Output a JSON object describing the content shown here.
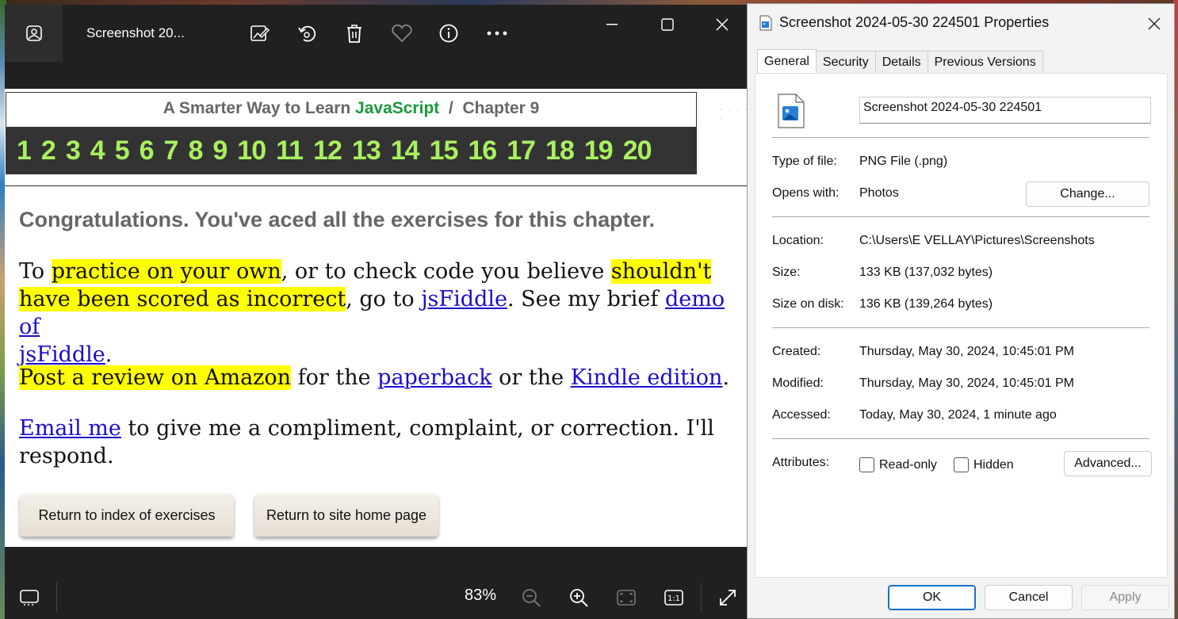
{
  "photos": {
    "title": "Screenshot 20...",
    "toolbar_icons": [
      "edit-image-icon",
      "rotate-icon",
      "delete-icon",
      "favorite-icon",
      "info-icon",
      "more-icon"
    ],
    "zoom": "83%",
    "bottom_icons": [
      "filmstrip-icon",
      "zoom-out-icon",
      "zoom-in-icon",
      "fit-to-window-icon",
      "actual-size-icon",
      "fullscreen-icon"
    ]
  },
  "webpage": {
    "header_prefix": "A Smarter Way to Learn ",
    "header_js": "JavaScript",
    "header_suffix": "  /  Chapter 9",
    "chapters": [
      "1",
      "2",
      "3",
      "4",
      "5",
      "6",
      "7",
      "8",
      "9",
      "10",
      "11",
      "12",
      "13",
      "14",
      "15",
      "16",
      "17",
      "18",
      "19",
      "20"
    ],
    "congrats": "Congratulations. You've aced all the exercises for this chapter.",
    "p1": {
      "t1": "To ",
      "hl1": "practice on your own",
      "t2": ", or to check code you believe ",
      "hl2a": "shouldn't",
      "hl2b": "have been scored as incorrect",
      "t3": ", go to ",
      "link1": "jsFiddle",
      "t4": ". See my brief ",
      "link2a": "demo of",
      "link2b": "jsFiddle",
      "t5": "."
    },
    "p2": {
      "hl": "Post a review on Amazon",
      "t1": " for the ",
      "link1": "paperback",
      "t2": " or the ",
      "link2": "Kindle edition",
      "t3": "."
    },
    "p3": {
      "link": "Email me",
      "t1": " to give me a compliment, complaint, or correction. I'll",
      "t2": "respond."
    },
    "buttons": {
      "index": "Return to index of exercises",
      "home": "Return to site home page"
    }
  },
  "properties": {
    "title": "Screenshot 2024-05-30 224501 Properties",
    "tabs": [
      "General",
      "Security",
      "Details",
      "Previous Versions"
    ],
    "filename": "Screenshot 2024-05-30 224501",
    "type_label": "Type of file:",
    "type_value": "PNG File (.png)",
    "opens_label": "Opens with:",
    "opens_value": "Photos",
    "change_button": "Change...",
    "location_label": "Location:",
    "location_value": "C:\\Users\\E VELLAY\\Pictures\\Screenshots",
    "size_label": "Size:",
    "size_value": "133 KB (137,032 bytes)",
    "size_disk_label": "Size on disk:",
    "size_disk_value": "136 KB (139,264 bytes)",
    "created_label": "Created:",
    "created_value": "Thursday, May 30, 2024, 10:45:01 PM",
    "modified_label": "Modified:",
    "modified_value": "Thursday, May 30, 2024, 10:45:01 PM",
    "accessed_label": "Accessed:",
    "accessed_value": "Today, May 30, 2024, 1 minute ago",
    "attributes_label": "Attributes:",
    "readonly_label": "Read-only",
    "hidden_label": "Hidden",
    "advanced_button": "Advanced...",
    "ok_button": "OK",
    "cancel_button": "Cancel",
    "apply_button": "Apply"
  }
}
